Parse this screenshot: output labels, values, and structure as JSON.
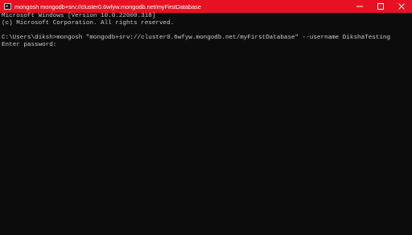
{
  "window": {
    "title": "mongosh mongodb+srv://cluster0.6wfyw.mongodb.net/myFirstDatabase",
    "app_icon": "terminal-icon",
    "controls": [
      "minimize-icon",
      "maximize-icon",
      "close-icon"
    ],
    "titlebar_color": "#e81123",
    "background_color": "#0c0c0c",
    "text_color": "#cccccc"
  },
  "console": {
    "lines": [
      "Microsoft Windows [Version 10.0.22000.318]",
      "(c) Microsoft Corporation. All rights reserved.",
      "",
      "C:\\Users\\diksh>mongosh \"mongodb+srv://cluster0.6wfyw.mongodb.net/myFirstDatabase\" --username DikshaTesting",
      "Enter password:"
    ]
  }
}
